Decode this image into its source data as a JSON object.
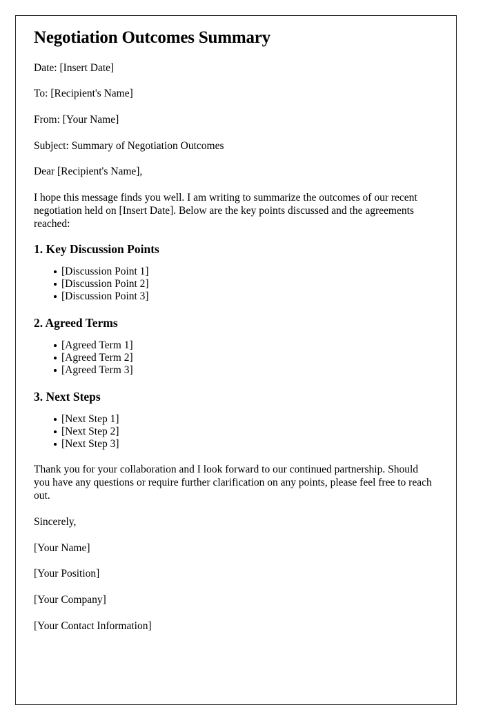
{
  "document": {
    "title": "Negotiation Outcomes Summary",
    "meta": [
      {
        "label": "Date:",
        "value": "[Insert Date]",
        "text": "Date: [Insert Date]"
      },
      {
        "label": "To:",
        "value": "[Recipient's Name]",
        "text": "To: [Recipient's Name]"
      },
      {
        "label": "From:",
        "value": "[Your Name]",
        "text": "From: [Your Name]"
      },
      {
        "label": "Subject:",
        "value": "Summary of Negotiation Outcomes",
        "text": "Subject: Summary of Negotiation Outcomes"
      }
    ],
    "salutation": "Dear [Recipient's Name],",
    "intro_paragraph": "I hope this message finds you well. I am writing to summarize the outcomes of our recent negotiation held on [Insert Date]. Below are the key points discussed and the agreements reached:",
    "sections": [
      {
        "heading": "1. Key Discussion Points",
        "items": [
          "[Discussion Point 1]",
          "[Discussion Point 2]",
          "[Discussion Point 3]"
        ]
      },
      {
        "heading": "2. Agreed Terms",
        "items": [
          "[Agreed Term 1]",
          "[Agreed Term 2]",
          "[Agreed Term 3]"
        ]
      },
      {
        "heading": "3. Next Steps",
        "items": [
          "[Next Step 1]",
          "[Next Step 2]",
          "[Next Step 3]"
        ]
      }
    ],
    "closing_paragraph": "Thank you for your collaboration and I look forward to our continued partnership. Should you have any questions or require further clarification on any points, please feel free to reach out.",
    "signoff": "Sincerely,",
    "signature": [
      "[Your Name]",
      "[Your Position]",
      "[Your Company]",
      "[Your Contact Information]"
    ]
  },
  "style": {
    "text_color": "#000000",
    "page_background": "#ffffff",
    "border_color": "#2b2b2b"
  }
}
